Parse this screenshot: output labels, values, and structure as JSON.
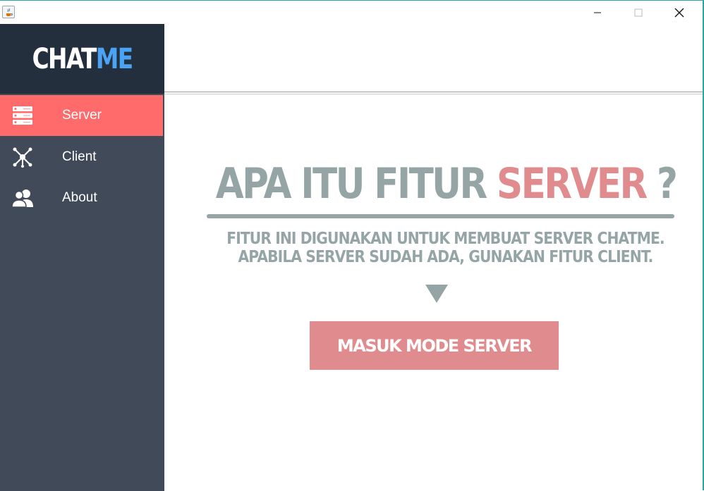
{
  "window": {
    "minimize_glyph": "—",
    "maximize_glyph": "☐",
    "close_glyph": "✕"
  },
  "sidebar": {
    "logo_part1": "CHAT",
    "logo_part2": "ME",
    "items": [
      {
        "label": "Server",
        "icon": "server-icon",
        "active": true
      },
      {
        "label": "Client",
        "icon": "network-icon",
        "active": false
      },
      {
        "label": "About",
        "icon": "users-icon",
        "active": false
      }
    ]
  },
  "main": {
    "headline_prefix": "APA ITU FITUR ",
    "headline_accent": "SERVER",
    "headline_suffix": " ?",
    "description_line1": "FITUR INI DIGUNAKAN UNTUK MEMBUAT SERVER CHATME.",
    "description_line2": "APABILA SERVER SUDAH ADA, GUNAKAN FITUR CLIENT.",
    "button_label": "MASUK MODE SERVER"
  },
  "colors": {
    "sidebar_bg": "#414a59",
    "logo_bg": "#242f3d",
    "active_item": "#ff6b6b",
    "accent": "#e08c8e",
    "muted_text": "#95a5a6",
    "logo_me": "#4aa3f5"
  }
}
